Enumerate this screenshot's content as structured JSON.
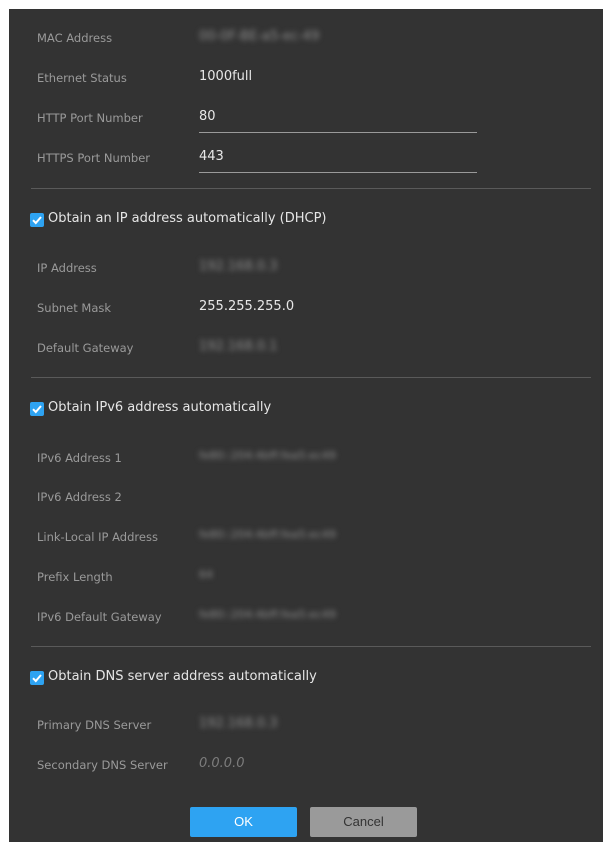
{
  "fields_top": [
    {
      "label": "MAC Address",
      "value": "00-0F-BE-a5-ec-49"
    },
    {
      "label": "Ethernet Status",
      "value": "1000full"
    },
    {
      "label": "HTTP Port Number",
      "value": "80"
    },
    {
      "label": "HTTPS Port Number",
      "value": "443"
    }
  ],
  "dhcp": {
    "checkbox_label": "Obtain an IP address automatically (DHCP)",
    "checked": true,
    "fields": [
      {
        "label": "IP Address",
        "value": "192.168.0.3"
      },
      {
        "label": "Subnet Mask",
        "value": "255.255.255.0"
      },
      {
        "label": "Default Gateway",
        "value": "192.168.0.1"
      }
    ]
  },
  "ipv6": {
    "checkbox_label": "Obtain IPv6 address automatically",
    "checked": true,
    "fields": [
      {
        "label": "IPv6 Address 1",
        "value": "fe80::204:4bff:fea5:ec49"
      },
      {
        "label": "IPv6 Address 2",
        "value": ""
      },
      {
        "label": "Link-Local IP Address",
        "value": "fe80::204:4bff:fea5:ec49"
      },
      {
        "label": "Prefix Length",
        "value": "64"
      },
      {
        "label": "IPv6 Default Gateway",
        "value": "fe80::204:4bff:fea5:ec49"
      }
    ]
  },
  "dns": {
    "checkbox_label": "Obtain DNS server address automatically",
    "checked": true,
    "fields": [
      {
        "label": "Primary DNS Server",
        "value": "192.168.0.3"
      },
      {
        "label": "Secondary DNS Server",
        "value": "0.0.0.0"
      }
    ]
  },
  "buttons": {
    "ok": "OK",
    "cancel": "Cancel"
  },
  "colors": {
    "panel": "#333333",
    "accent": "#2ea3f2",
    "cancel": "#9a9a9a"
  }
}
